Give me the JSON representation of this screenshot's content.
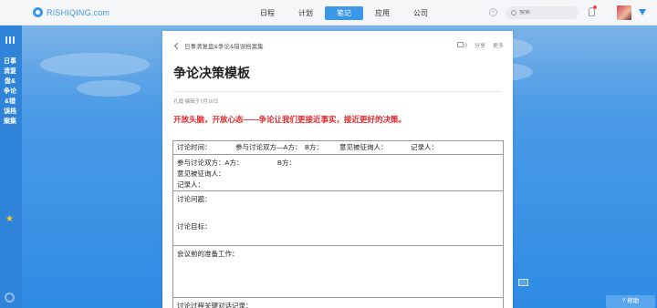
{
  "brand": {
    "name": "RISHIQING.com"
  },
  "nav": {
    "items": [
      "日程",
      "计划",
      "笔记",
      "应用",
      "公司"
    ],
    "active_index": 2
  },
  "search": {
    "placeholder": "搜索"
  },
  "sidebar": {
    "title": "日事清复盘&争论&错误档案集"
  },
  "note": {
    "breadcrumb": "日事清复盘&争论&错误档案集",
    "comment_count": "0",
    "share_label": "分享",
    "more_label": "更多",
    "title": "争论决策模板",
    "meta": "孔霞 编辑于7月16日",
    "slogan": "开放头脑，开放心态——争论让我们更接近事实，接近更好的决策。"
  },
  "form": {
    "row1": [
      "讨论时间：",
      "参与讨论双方—A方：",
      "B方：",
      "意见被征询人：",
      "记录人："
    ],
    "row2": {
      "line1_a": "参与讨论双方：A方：",
      "line1_b": "B方：",
      "line2": "意见被征询人：",
      "line3": "记录人："
    },
    "row3": {
      "line1": "讨论问题：",
      "line2": "讨论目标："
    },
    "row4": "会议前的准备工作：",
    "row5": "讨论过程关键对话记录："
  },
  "help": {
    "label": "帮助"
  },
  "colors": {
    "accent": "#3b97e8",
    "slogan": "#e8262a"
  }
}
